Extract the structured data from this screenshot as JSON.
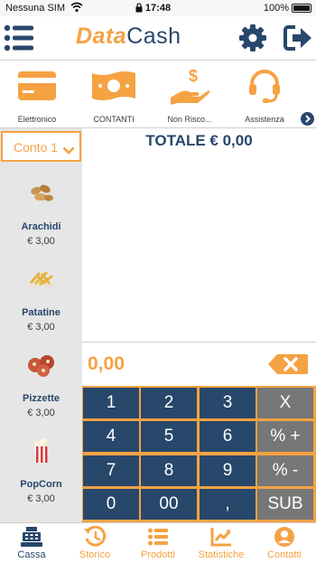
{
  "statusbar": {
    "carrier": "Nessuna SIM",
    "time": "17:48",
    "battery": "100%"
  },
  "header": {
    "logo_part1": "Data",
    "logo_part2": "Cash"
  },
  "payments": [
    {
      "label": "Elettronico",
      "icon": "credit-card-icon"
    },
    {
      "label": "CONTANTI",
      "icon": "cash-bill-icon"
    },
    {
      "label": "Non Risco...",
      "icon": "hand-dollar-icon"
    },
    {
      "label": "Assistenza",
      "icon": "headset-icon"
    }
  ],
  "account": {
    "selected": "Conto 1"
  },
  "products": [
    {
      "name": "Arachidi",
      "price": "€ 3,00"
    },
    {
      "name": "Patatine",
      "price": "€ 3,00"
    },
    {
      "name": "Pizzette",
      "price": "€ 3,00"
    },
    {
      "name": "PopCorn",
      "price": "€ 3,00"
    }
  ],
  "receipt": {
    "total": "TOTALE € 0,00"
  },
  "keypad": {
    "display": "0,00",
    "keys": [
      "1",
      "2",
      "3",
      "X",
      "4",
      "5",
      "6",
      "% +",
      "7",
      "8",
      "9",
      "% -",
      "0",
      "00",
      ",",
      "SUB"
    ]
  },
  "tabs": [
    {
      "label": "Cassa",
      "icon": "cash-register-icon"
    },
    {
      "label": "Storico",
      "icon": "history-icon"
    },
    {
      "label": "Prodotti",
      "icon": "list-icon"
    },
    {
      "label": "Statistiche",
      "icon": "chart-icon"
    },
    {
      "label": "Contatti",
      "icon": "contact-icon"
    }
  ],
  "colors": {
    "orange": "#f5a243",
    "navy": "#27476b",
    "grey_key": "#777777",
    "sidebar": "#e6e6e6"
  }
}
